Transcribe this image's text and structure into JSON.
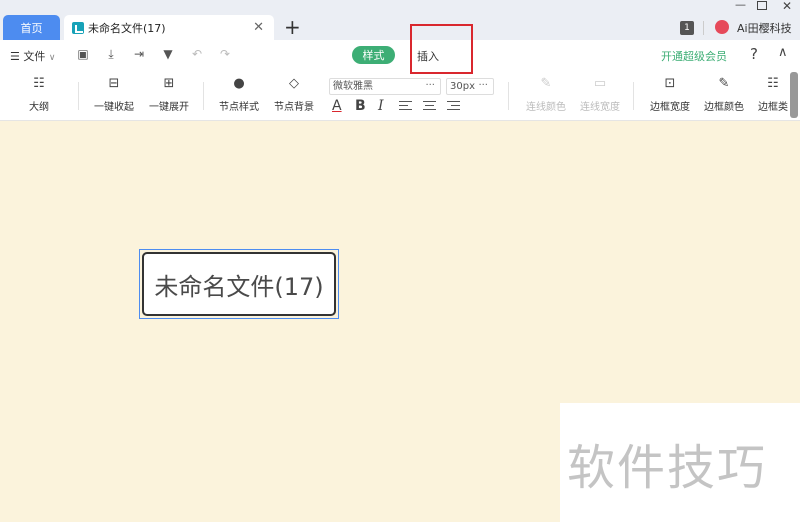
{
  "tabs": {
    "home_label": "首页",
    "doc_label": "未命名文件(17)",
    "add_label": "+"
  },
  "window": {
    "badge": "1",
    "user_name": "Ai田樱科技",
    "minimize": "—",
    "close": "✕"
  },
  "menubar": {
    "file_label": "文件",
    "style_tab": "样式",
    "insert_tab": "插入",
    "vip_label": "开通超级会员",
    "help": "?",
    "collapse": "∧"
  },
  "toolbar": {
    "outline": "大纲",
    "collapse_all": "一键收起",
    "expand_all": "一键展开",
    "node_style": "节点样式",
    "node_bg": "节点背景",
    "font_family": "微软雅黑",
    "font_size": "30px",
    "bold": "B",
    "italic": "I",
    "underline": "A",
    "line_color": "连线颜色",
    "line_width": "连线宽度",
    "border_width": "边框宽度",
    "border_color": "边框颜色",
    "border_type": "边框类"
  },
  "canvas": {
    "root_node": "未命名文件(17)",
    "watermark": "软件技巧"
  },
  "colors": {
    "canvas_bg": "#fbf3dc",
    "accent_green": "#3dae75",
    "accent_blue": "#4d8cf0",
    "highlight_red": "#d9272e"
  }
}
